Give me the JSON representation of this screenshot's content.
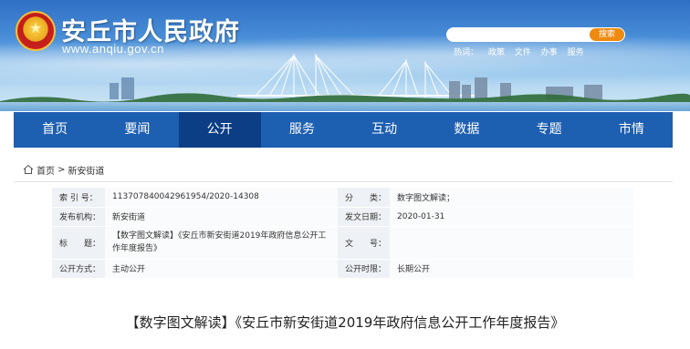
{
  "header": {
    "site_title": "安丘市人民政府",
    "site_url": "www.anqiu.gov.cn",
    "emblem_icon": "national-emblem",
    "search": {
      "placeholder": "",
      "button_label": "搜索"
    },
    "hotwords": {
      "label": "热词：",
      "items": [
        "政策",
        "文件",
        "办事",
        "服务"
      ]
    }
  },
  "nav": {
    "items": [
      {
        "label": "首页"
      },
      {
        "label": "要闻"
      },
      {
        "label": "公开"
      },
      {
        "label": "服务"
      },
      {
        "label": "互动"
      },
      {
        "label": "数据"
      },
      {
        "label": "专题"
      },
      {
        "label": "市情"
      }
    ],
    "active_index": 2,
    "bg_color": "#1d5fb1",
    "active_color": "#0c3e86"
  },
  "breadcrumb": {
    "home_icon": "home-icon",
    "home": "首页",
    "separator": ">",
    "current": "新安街道"
  },
  "info": {
    "index_label": "索 引 号：",
    "index_value": "11370784004296195​4/2020-14308",
    "category_label": "分　　类：",
    "category_value": "数字图文解读；",
    "publisher_label": "发布机构：",
    "publisher_value": "新安街道",
    "date_label": "发文日期：",
    "date_value": "2020-01-31",
    "title_label": "标　　题：",
    "title_value": "【数字图文解读】《安丘市新安街道2019年政府信息公开工作年度报告》",
    "docno_label": "文　　号：",
    "docno_value": "",
    "method_label": "公开方式：",
    "method_value": "主动公开",
    "period_label": "公开时限：",
    "period_value": "长期公开"
  },
  "article": {
    "title": "【数字图文解读】《安丘市新安街道2019年政府信息公开工作年度报告》"
  }
}
